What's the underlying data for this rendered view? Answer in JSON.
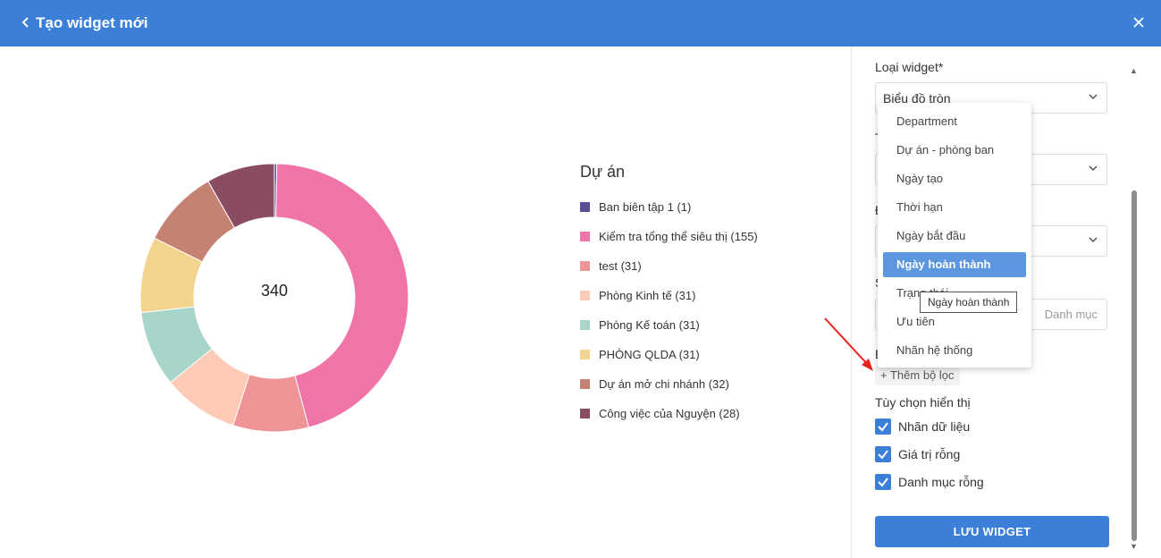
{
  "header": {
    "title": "Tạo widget mới",
    "back_icon": "chevron-left-icon",
    "close_icon": "close-icon"
  },
  "chart_data": {
    "type": "pie",
    "title": "Dự án",
    "total": "340",
    "categories": [
      "Ban biên tập 1 (1)",
      "Kiểm tra tổng thể siêu thị (155)",
      "test (31)",
      "Phòng Kinh tế (31)",
      "Phòng Kế toán (31)",
      "PHÒNG QLDA (31)",
      "Dự án mở chi nhánh (32)",
      "Công việc của Nguyện (28)"
    ],
    "values": [
      1,
      155,
      31,
      31,
      31,
      31,
      32,
      28
    ],
    "colors": [
      "#5a4e96",
      "#f174a8",
      "#ee9496",
      "#fccab5",
      "#a8d5ca",
      "#f2d48e",
      "#c58273",
      "#8a4c62"
    ],
    "legend_position": "right"
  },
  "panel": {
    "widget_type_label": "Loại widget*",
    "widget_type_value": "Biểu đồ tròn",
    "category_placeholder": "Danh mục",
    "add_filter_label": "Thêm bộ lọc",
    "display_options_title": "Tùy chọn hiển thị",
    "options": [
      {
        "label": "Nhãn dữ liệu",
        "checked": true
      },
      {
        "label": "Giá trị rỗng",
        "checked": true
      },
      {
        "label": "Danh mục rỗng",
        "checked": true
      }
    ],
    "save_label": "LƯU WIDGET"
  },
  "dropdown": {
    "items": [
      "Department",
      "Dự án - phòng ban",
      "Ngày tạo",
      "Thời hạn",
      "Ngày bắt đầu",
      "Ngày hoàn thành",
      "Trạng thái",
      "Ưu tiên",
      "Nhãn hệ thống"
    ],
    "selected": "Ngày hoàn thành"
  },
  "tooltip": {
    "text": "Ngày hoàn thành"
  },
  "colors": {
    "accent": "#3b7fd8",
    "annotation_arrow": "#e8231c"
  }
}
